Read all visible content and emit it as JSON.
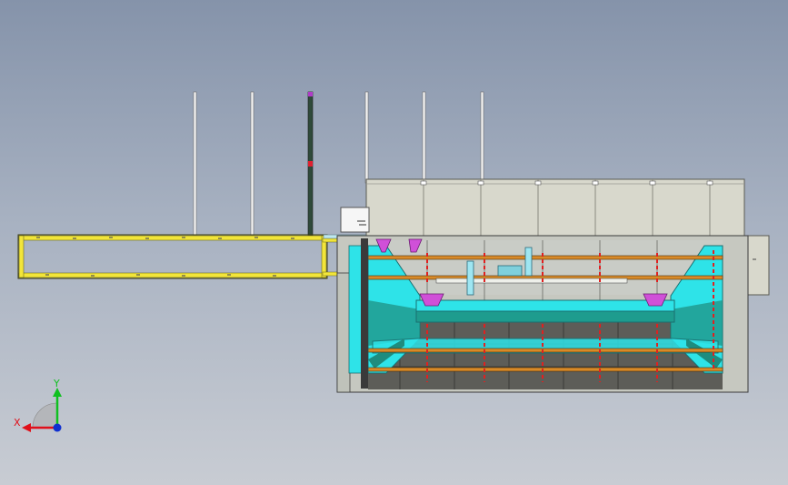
{
  "viewport": {
    "background_top": "#8593aa",
    "background_bottom": "#c8ccd3"
  },
  "triad": {
    "x_label": "X",
    "y_label": "Y",
    "x_color": "#e0101a",
    "y_color": "#10c020",
    "z_color": "#1030d0"
  },
  "colors": {
    "frame_yellow": "#f2e53a",
    "hopper_cyan": "#2ee3e8",
    "teal": "#1e8c7e",
    "panel_beige": "#d8d8cc",
    "dark_gray": "#5d5d58",
    "magenta": "#d050d8",
    "red_marker": "#e02020",
    "orange_rail": "#d88a28"
  }
}
